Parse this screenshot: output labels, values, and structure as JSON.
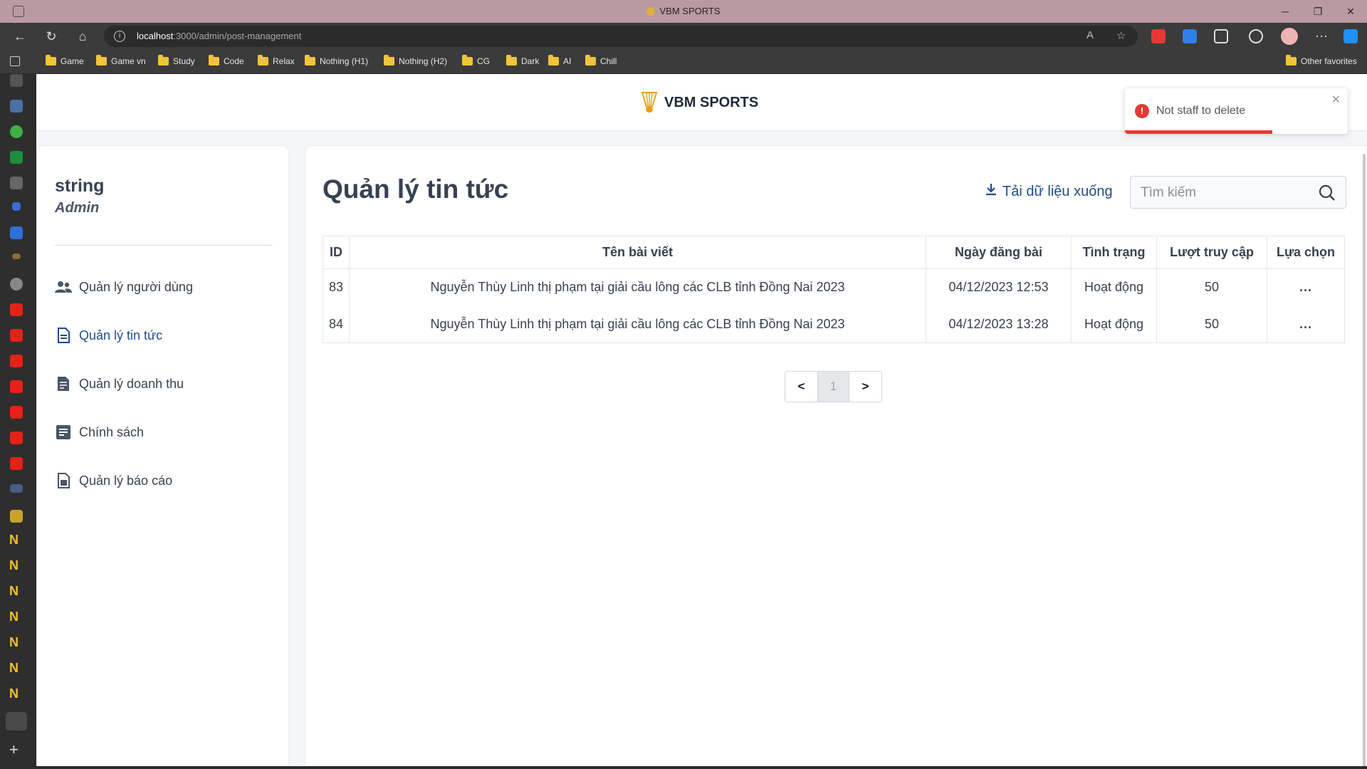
{
  "window": {
    "title": "VBM SPORTS",
    "controls": {
      "minimize": "─",
      "restore": "❐",
      "close": "✕"
    }
  },
  "browser": {
    "url_host": "localhost",
    "url_path": ":3000/admin/post-management",
    "bookmarks": [
      "Game",
      "Game vn",
      "Study",
      "Code",
      "Relax",
      "Nothing (H1)",
      "Nothing (H2)",
      "CG",
      "Dark",
      "AI",
      "Chill"
    ],
    "other_favorites": "Other favorites"
  },
  "app": {
    "brand": "VBM SPORTS",
    "accent_color": "#1f4b8f",
    "user": {
      "name": "string",
      "role": "Admin"
    },
    "nav": [
      {
        "label": "Quản lý người dùng",
        "icon": "users-icon",
        "active": false
      },
      {
        "label": "Quản lý tin tức",
        "icon": "document-icon",
        "active": true
      },
      {
        "label": "Quản lý doanh thu",
        "icon": "receipt-icon",
        "active": false
      },
      {
        "label": "Chính sách",
        "icon": "policy-icon",
        "active": false
      },
      {
        "label": "Quản lý báo cáo",
        "icon": "report-icon",
        "active": false
      }
    ]
  },
  "main": {
    "title": "Quản lý tin tức",
    "download_label": "Tải dữ liệu xuống",
    "search_placeholder": "Tìm kiếm",
    "table": {
      "headers": [
        "ID",
        "Tên bài viết",
        "Ngày đăng bài",
        "Tình trạng",
        "Lượt truy cập",
        "Lựa chọn"
      ],
      "rows": [
        {
          "id": "83",
          "title": "Nguyễn Thùy Linh thị phạm tại giải cầu lông các CLB tỉnh Đồng Nai 2023",
          "date": "04/12/2023 12:53",
          "status": "Hoạt động",
          "views": "50",
          "action": "..."
        },
        {
          "id": "84",
          "title": "Nguyễn Thùy Linh thị phạm tại giải cầu lông các CLB tỉnh Đồng Nai 2023",
          "date": "04/12/2023 13:28",
          "status": "Hoạt động",
          "views": "50",
          "action": "..."
        }
      ]
    },
    "pagination": {
      "prev": "<",
      "current": "1",
      "next": ">"
    }
  },
  "toast": {
    "message": "Not staff to delete",
    "type": "error",
    "color": "#e53935",
    "progress": 0.66
  }
}
